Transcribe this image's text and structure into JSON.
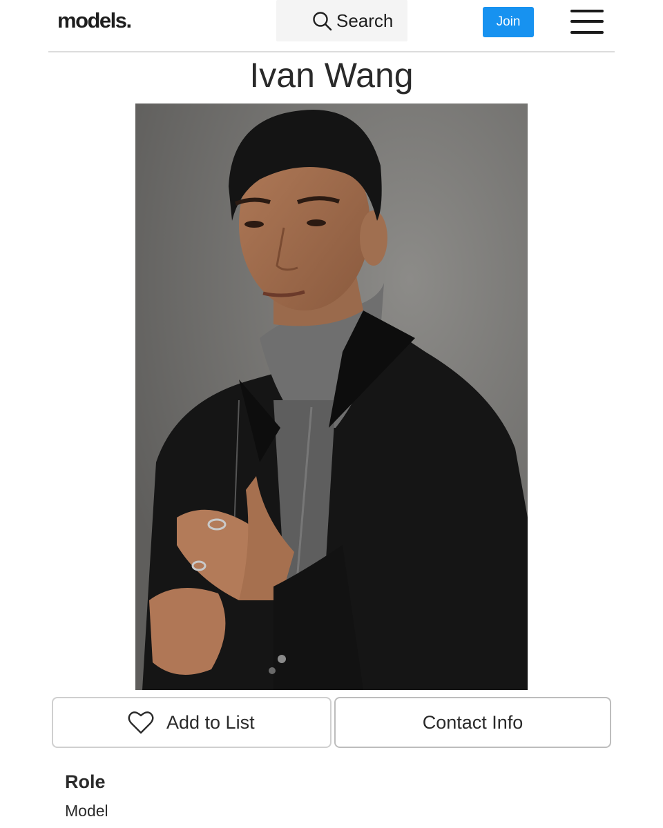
{
  "header": {
    "logo": "models.",
    "search_label": "Search",
    "join_label": "Join",
    "menu_icon": "hamburger-menu-icon",
    "accent_color": "#1792f0"
  },
  "profile": {
    "name": "Ivan Wang",
    "photo_description": "studio-portrait"
  },
  "actions": {
    "add_to_list_label": "Add to List",
    "add_to_list_icon": "heart-icon",
    "contact_info_label": "Contact Info"
  },
  "details": {
    "role_heading": "Role",
    "role_value": "Model"
  }
}
